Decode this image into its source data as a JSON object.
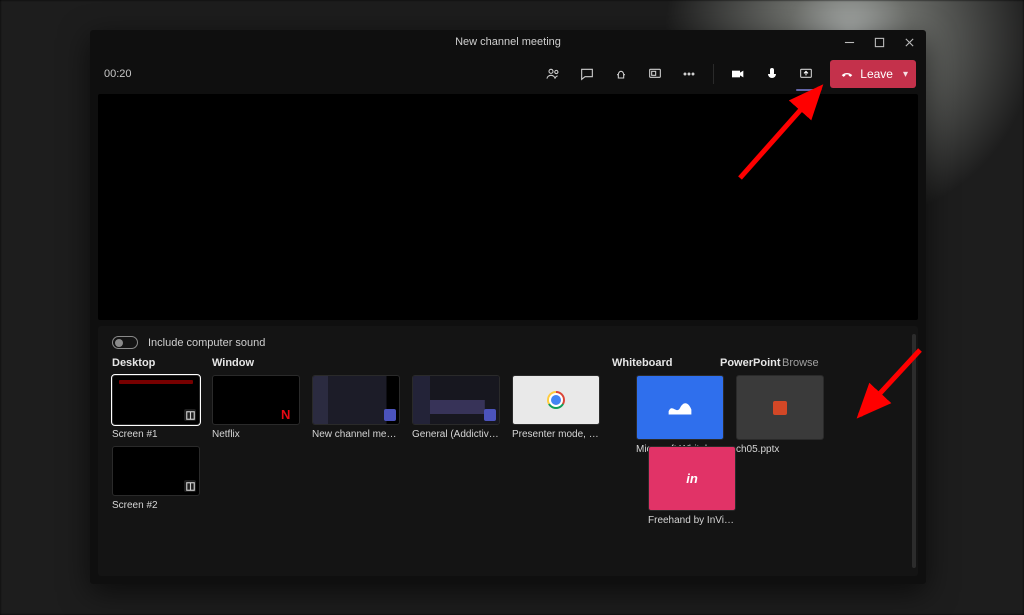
{
  "window": {
    "title": "New channel meeting"
  },
  "toolbar": {
    "timer": "00:20",
    "leave_label": "Leave"
  },
  "tray": {
    "include_sound_label": "Include computer sound",
    "headings": {
      "desktop": "Desktop",
      "window": "Window",
      "whiteboard": "Whiteboard",
      "powerpoint": "PowerPoint",
      "browse": "Browse"
    },
    "desktop_tiles": [
      {
        "label": "Screen #1"
      },
      {
        "label": "Screen #2"
      }
    ],
    "window_tiles": [
      {
        "label": "Netflix"
      },
      {
        "label": "New channel meeting | …"
      },
      {
        "label": "General (AddictiveTips - …"
      },
      {
        "label": "Presenter mode, notes a…"
      }
    ],
    "whiteboard_tiles": [
      {
        "label": "Microsoft Whiteboard"
      },
      {
        "label": "Freehand by InVision"
      }
    ],
    "powerpoint_tiles": [
      {
        "label": "ch05.pptx"
      }
    ]
  },
  "annotation": {
    "arrow1_target": "share-content-button",
    "arrow2_target": "browse-link"
  }
}
